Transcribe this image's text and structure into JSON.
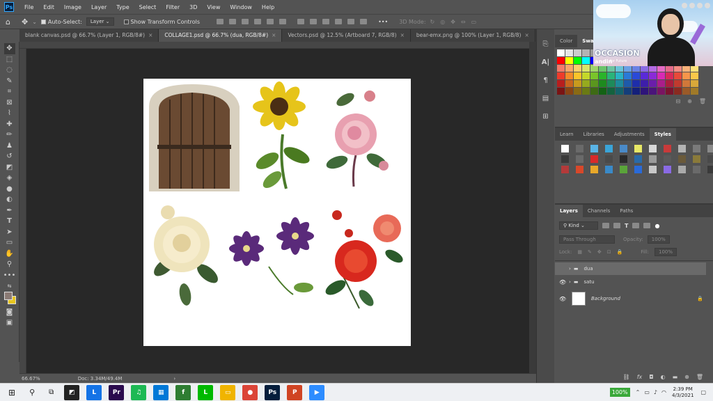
{
  "app": {
    "logo": "Ps",
    "menu": [
      "File",
      "Edit",
      "Image",
      "Layer",
      "Type",
      "Select",
      "Filter",
      "3D",
      "View",
      "Window",
      "Help"
    ]
  },
  "options": {
    "auto_select_label": "Auto-Select:",
    "auto_select_value": "Layer",
    "show_transform_label": "Show Transform Controls",
    "mode_3d_label": "3D Mode:"
  },
  "tabs": [
    {
      "label": "blank canvas.psd @ 66.7% (Layer 1, RGB/8#)",
      "close": "×"
    },
    {
      "label": "COLLAGE1.psd @ 66.7% (dua, RGB/8#)",
      "close": "×"
    },
    {
      "label": "Vectors.psd @ 12.5% (Artboard 7, RGB/8)",
      "close": "×"
    },
    {
      "label": "bear-emx.png @ 100% (Layer 1, RGB/8)",
      "close": "×"
    }
  ],
  "status": {
    "zoom": "66.67%",
    "doc": "Doc: 3.34M/49.4M",
    "arrow": "›"
  },
  "color_panel": {
    "tabs": [
      "Color",
      "Swatch"
    ]
  },
  "styles_panel": {
    "tabs": [
      "Learn",
      "Libraries",
      "Adjustments",
      "Styles"
    ]
  },
  "layers_panel": {
    "tabs": [
      "Layers",
      "Channels",
      "Paths"
    ],
    "kind_label": "Kind",
    "blend_mode": "Pass Through",
    "opacity_label": "Opacity:",
    "opacity_value": "100%",
    "lock_label": "Lock:",
    "fill_label": "Fill:",
    "fill_value": "100%",
    "layers": [
      {
        "name": "dua",
        "type": "group",
        "visible": false,
        "selected": true
      },
      {
        "name": "satu",
        "type": "group",
        "visible": true,
        "selected": false
      },
      {
        "name": "Background",
        "type": "background",
        "visible": true,
        "selected": false
      }
    ]
  },
  "webcam": {
    "banner_text": "OCCASION",
    "sub_text": "andin",
    "sub_text2": "for Future"
  },
  "taskbar": {
    "zoom_badge": "100%",
    "time": "2:39 PM",
    "date": "4/3/2021",
    "apps": [
      {
        "name": "Lightroom",
        "letter": "L",
        "color": "#1473e6"
      },
      {
        "name": "Premiere",
        "letter": "Pr",
        "color": "#2a0a4e"
      },
      {
        "name": "Spotify",
        "letter": "♫",
        "color": "#1db954"
      },
      {
        "name": "Calculator",
        "letter": "▦",
        "color": "#0078d7"
      },
      {
        "name": "Feedly",
        "letter": "f",
        "color": "#2e7d32"
      },
      {
        "name": "Line",
        "letter": "L",
        "color": "#00b900"
      },
      {
        "name": "Explorer",
        "letter": "▭",
        "color": "#f0b400"
      },
      {
        "name": "Chrome",
        "letter": "●",
        "color": "#db4437"
      },
      {
        "name": "Photoshop",
        "letter": "Ps",
        "color": "#061e3c"
      },
      {
        "name": "PowerPoint",
        "letter": "P",
        "color": "#d04423"
      },
      {
        "name": "Zoom",
        "letter": "▶",
        "color": "#2d8cff"
      }
    ]
  }
}
